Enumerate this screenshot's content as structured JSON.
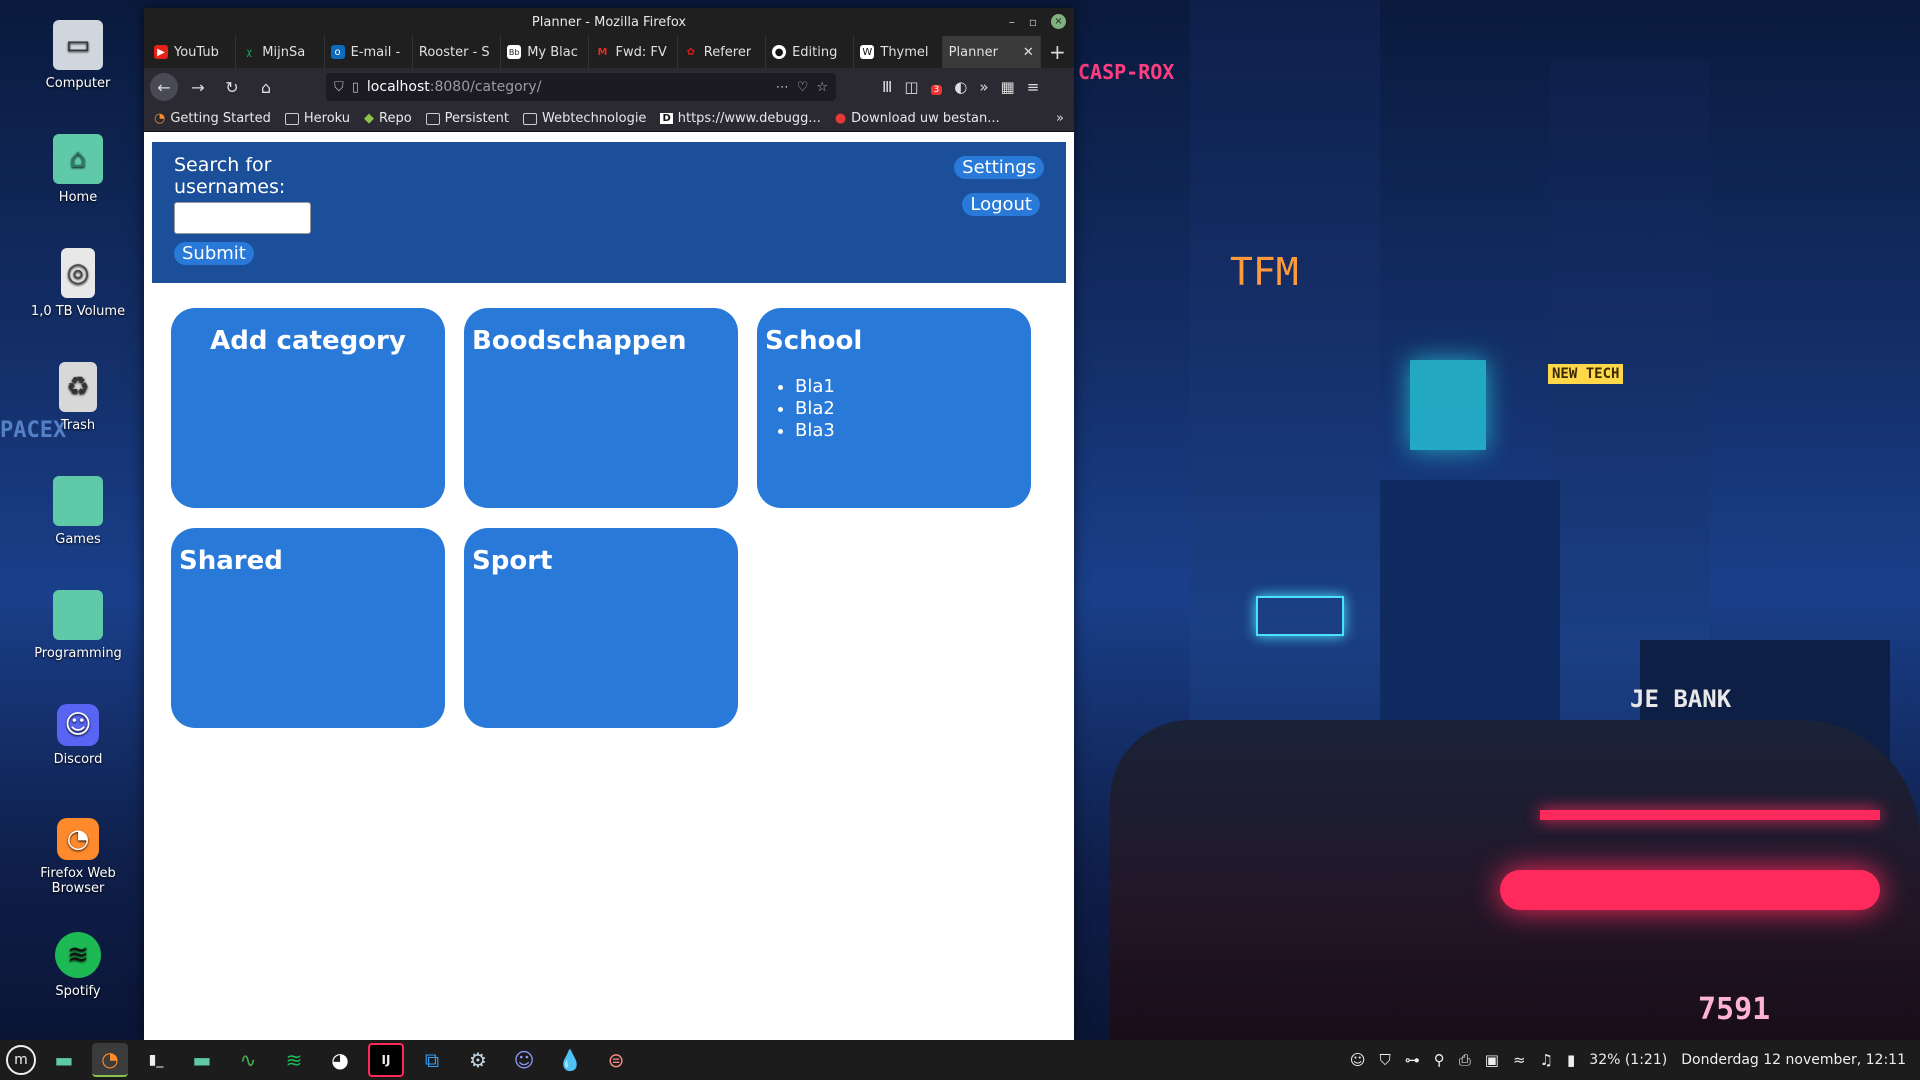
{
  "wallpaper": {
    "signs": [
      "CASP-ROX",
      "TFM",
      "NEW TECH",
      "JE BANK",
      "7591",
      "PACEX"
    ]
  },
  "desktop_icons": [
    {
      "label": "Computer",
      "icon": "computer-icon"
    },
    {
      "label": "Home",
      "icon": "folder-icon"
    },
    {
      "label": "1,0 TB Volume",
      "icon": "drive-icon"
    },
    {
      "label": "Trash",
      "icon": "trash-icon"
    },
    {
      "label": "Games",
      "icon": "folder-icon"
    },
    {
      "label": "Programming",
      "icon": "folder-icon"
    },
    {
      "label": "Discord",
      "icon": "discord-icon"
    },
    {
      "label": "Firefox Web Browser",
      "icon": "firefox-icon"
    },
    {
      "label": "Spotify",
      "icon": "spotify-icon"
    }
  ],
  "window": {
    "title": "Planner - Mozilla Firefox",
    "controls": {
      "minimize": "–",
      "maximize": "▫",
      "close": "×"
    }
  },
  "tabs": [
    {
      "label": "YouTub",
      "icon": "youtube-icon",
      "color": "#e62117"
    },
    {
      "label": "MijnSa",
      "icon": "mijnsax-icon",
      "color": "#1aa260"
    },
    {
      "label": "E-mail -",
      "icon": "outlook-icon",
      "color": "#0f6cbd"
    },
    {
      "label": "Rooster - S",
      "icon": "",
      "color": ""
    },
    {
      "label": "My Blac",
      "icon": "blackboard-icon",
      "color": "#444444"
    },
    {
      "label": "Fwd: FV",
      "icon": "gmail-icon",
      "color": "#d93025"
    },
    {
      "label": "Referer",
      "icon": "reference-icon",
      "color": "#d7191c"
    },
    {
      "label": "Editing",
      "icon": "github-icon",
      "color": "#ffffff"
    },
    {
      "label": "Thymel",
      "icon": "wikipedia-icon",
      "color": "#ffffff"
    },
    {
      "label": "Planner",
      "icon": "",
      "color": "",
      "active": true
    }
  ],
  "tab_close": "✕",
  "tab_new": "+",
  "nav": {
    "url_host": "localhost",
    "url_rest": ":8080/category/",
    "addon_badge": "3"
  },
  "bookmarks": [
    {
      "label": "Getting Started",
      "icon": "firefox-icon"
    },
    {
      "label": "Heroku",
      "icon": "folder-icon"
    },
    {
      "label": "Repo",
      "icon": "repo-icon"
    },
    {
      "label": "Persistent",
      "icon": "folder-icon"
    },
    {
      "label": "Webtechnologie",
      "icon": "folder-icon"
    },
    {
      "label": "https://www.debugg...",
      "icon": "debug-icon"
    },
    {
      "label": "Download uw bestan...",
      "icon": "download-icon"
    }
  ],
  "app": {
    "search_label": "Search for usernames:",
    "search_value": "",
    "submit_label": "Submit",
    "settings_label": "Settings",
    "logout_label": "Logout"
  },
  "categories": [
    {
      "title": "Add category",
      "items": [],
      "type": "add"
    },
    {
      "title": "Boodschappen",
      "items": []
    },
    {
      "title": "School",
      "items": [
        "Bla1",
        "Bla2",
        "Bla3"
      ]
    },
    {
      "title": "Shared",
      "items": []
    },
    {
      "title": "Sport",
      "items": []
    }
  ],
  "taskbar": {
    "apps": [
      "mint-menu-icon",
      "files-icon",
      "firefox-icon",
      "terminal-icon",
      "nemo-icon",
      "system-monitor-icon",
      "spotify-icon",
      "whatsapp-icon",
      "intellij-icon",
      "vscode-icon",
      "steam-icon",
      "discord-icon",
      "mailspring-icon",
      "redshift-icon"
    ],
    "battery": "32% (1:21)",
    "clock": "Donderdag 12 november, 12:11"
  },
  "colors": {
    "header": "#1b4f99",
    "card": "#2979d8",
    "button": "#2979d8"
  }
}
